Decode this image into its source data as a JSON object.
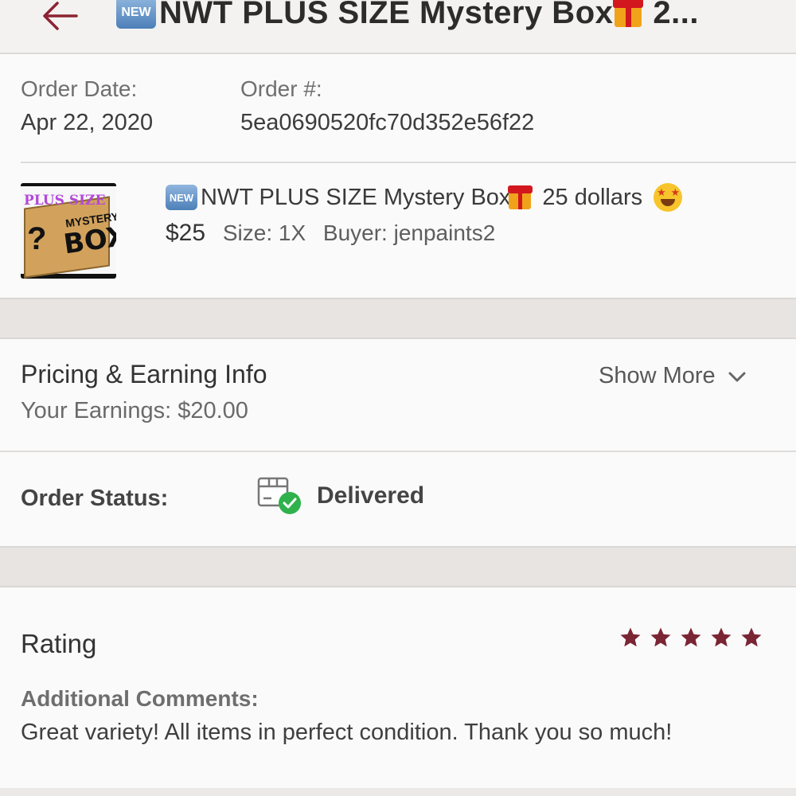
{
  "header": {
    "back_icon": "arrow-left-icon",
    "new_badge": "NEW",
    "title_text": "NWT PLUS SIZE Mystery Box",
    "gift_icon": "gift-emoji-icon",
    "title_suffix": "2...",
    "accent_color": "#8b2332"
  },
  "order": {
    "date_label": "Order Date:",
    "date_value": "Apr 22, 2020",
    "number_label": "Order #:",
    "number_value": "5ea0690520fc70d352e56f22"
  },
  "item": {
    "thumbnail_label": "PLUS SIZE",
    "thumbnail_text_1": "MYSTERY",
    "thumbnail_text_2": "BOX",
    "thumbnail_q": "?",
    "new_badge": "NEW",
    "title": "NWT PLUS SIZE Mystery Box",
    "title_tail": "25 dollars",
    "emoji_icon": "star-struck-emoji-icon",
    "price": "$25",
    "size": "Size: 1X",
    "buyer": "Buyer: jenpaints2"
  },
  "pricing": {
    "title": "Pricing & Earning Info",
    "earnings": "Your Earnings: $20.00",
    "show_more": "Show More"
  },
  "status": {
    "label": "Order Status:",
    "value": "Delivered",
    "icon": "package-delivered-icon",
    "check_color": "#2fb24c"
  },
  "rating": {
    "title": "Rating",
    "stars": 5,
    "max_stars": 5,
    "star_color": "#7a2533",
    "comments_label": "Additional Comments:",
    "comments_text": "Great variety! All items in perfect condition. Thank you so much!"
  }
}
